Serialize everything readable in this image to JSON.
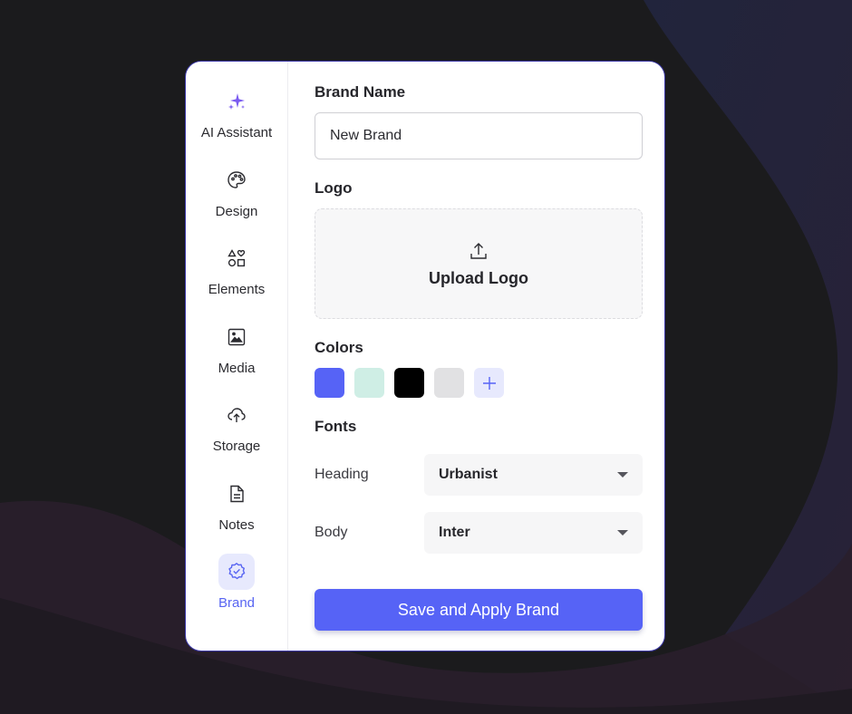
{
  "sidebar": {
    "items": [
      {
        "label": "AI Assistant",
        "icon": "sparkle-icon"
      },
      {
        "label": "Design",
        "icon": "palette-icon"
      },
      {
        "label": "Elements",
        "icon": "shapes-icon"
      },
      {
        "label": "Media",
        "icon": "image-icon"
      },
      {
        "label": "Storage",
        "icon": "cloud-upload-icon"
      },
      {
        "label": "Notes",
        "icon": "document-icon"
      },
      {
        "label": "Brand",
        "icon": "badge-check-icon",
        "active": true
      }
    ]
  },
  "brand": {
    "name_title": "Brand Name",
    "name_value": "New Brand",
    "logo_title": "Logo",
    "upload_label": "Upload Logo",
    "colors_title": "Colors",
    "colors": [
      "#5663f6",
      "#cfeee5",
      "#000000",
      "#e1e1e3"
    ],
    "fonts_title": "Fonts",
    "fonts": [
      {
        "label": "Heading",
        "value": "Urbanist"
      },
      {
        "label": "Body",
        "value": "Inter"
      }
    ],
    "save_label": "Save and Apply Brand"
  },
  "theme": {
    "accent": "#5663f6",
    "panel_border": "#3b37a6",
    "active_bg": "#e7e9fd"
  }
}
